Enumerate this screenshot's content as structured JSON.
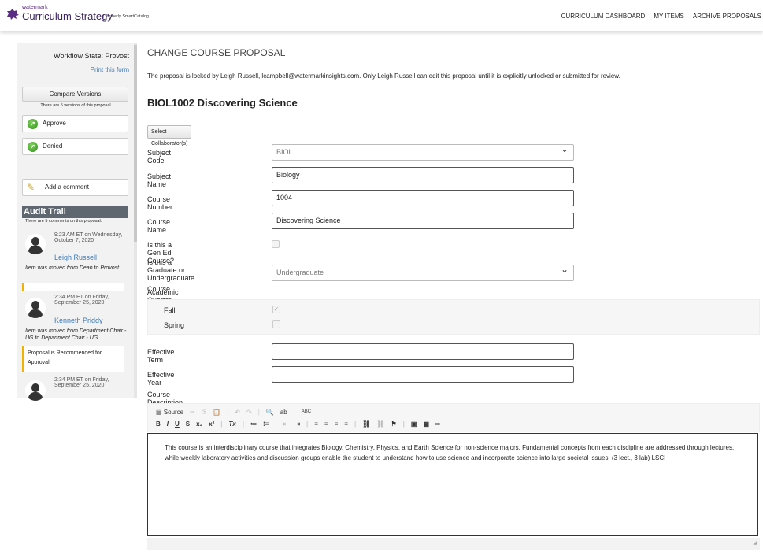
{
  "header": {
    "brand_small": "watermark",
    "brand": "Curriculum Strategy",
    "formerly": "| formerly SmartCatalog",
    "nav": [
      "CURRICULUM DASHBOARD",
      "MY ITEMS",
      "ARCHIVE PROPOSALS"
    ]
  },
  "sidebar": {
    "workflow_state": "Workflow State: Provost",
    "print": "Print this form",
    "compare": "Compare Versions",
    "versions_note": "There are 5 versions of this proposal",
    "approve": "Approve",
    "denied": "Denied",
    "add_comment": "Add a comment",
    "audit_title": "Audit Trail",
    "audit_count": "There are 5 comments on this proposal.",
    "entries": [
      {
        "time": "9:23 AM ET on Wednesday,",
        "date": "October 7, 2020",
        "name": "Leigh Russell",
        "message": "Item was moved from Dean to Provost"
      },
      {
        "time": "2:34 PM ET on Friday,",
        "date": "September 25, 2020",
        "name": "Kenneth Priddy",
        "message": "Item was moved from Department Chair - UG to Department Chair - UG"
      },
      {
        "time": "2:34 PM ET on Friday,",
        "date": "September 25, 2020"
      }
    ],
    "comment": "Proposal is Recommended for Approval"
  },
  "main": {
    "title": "CHANGE COURSE PROPOSAL",
    "lock_notice": "The proposal is locked by Leigh Russell, lcampbell@watermarkinsights.com. Only Leigh Russell can edit this proposal until it is explicitly unlocked or submitted for review.",
    "course_heading": "BIOL1002 Discovering Science",
    "collab_button": "Select Collaborator(s)",
    "fields": {
      "subject_code": {
        "label": "Subject Code",
        "value": "BIOL"
      },
      "subject_name": {
        "label": "Subject Name",
        "value": "Biology"
      },
      "course_number": {
        "label": "Course Number",
        "value": "1004"
      },
      "course_name": {
        "label": "Course Name",
        "value": "Discovering Science"
      },
      "gen_ed": {
        "label": "Is this a Gen Ed Course?",
        "checked": false
      },
      "level": {
        "label_1": "Is this a Graduate or Undergraduate",
        "label_2": "Course",
        "value": "Undergraduate"
      },
      "quarter": {
        "label": "Academic Quarter",
        "fall": "Fall",
        "fall_checked": true,
        "spring": "Spring",
        "spring_checked": false
      },
      "effective_term": {
        "label": "Effective Term",
        "value": ""
      },
      "effective_year": {
        "label": "Effective Year",
        "value": ""
      },
      "description": {
        "label": "Course Description",
        "value": "This course is an interdisciplinary course that integrates Biology, Chemistry, Physics, and Earth Science for non-science majors. Fundamental concepts from each discipline are addressed through lectures, while weekly laboratory activities and discussion groups enable the student to understand how to use science and incorporate science into large societal issues. (3 lect., 3 lab) LSCI"
      }
    },
    "toolbar": {
      "source": "Source",
      "row1": [
        "✂",
        "⎘",
        "📋",
        "|",
        "↶",
        "↷",
        "|",
        "🔍",
        "ab",
        "|",
        "ABC"
      ],
      "row2": [
        "B",
        "I",
        "U",
        "S",
        "x₂",
        "x²",
        "|",
        "Tx",
        "|",
        "≔",
        "⁝≡",
        "|",
        "⇤",
        "⇥",
        "|",
        "≡",
        "≡",
        "≡",
        "≡",
        "|",
        "⛓",
        "⛓",
        "⚑",
        "|",
        "▣",
        "▦",
        "═"
      ]
    }
  }
}
